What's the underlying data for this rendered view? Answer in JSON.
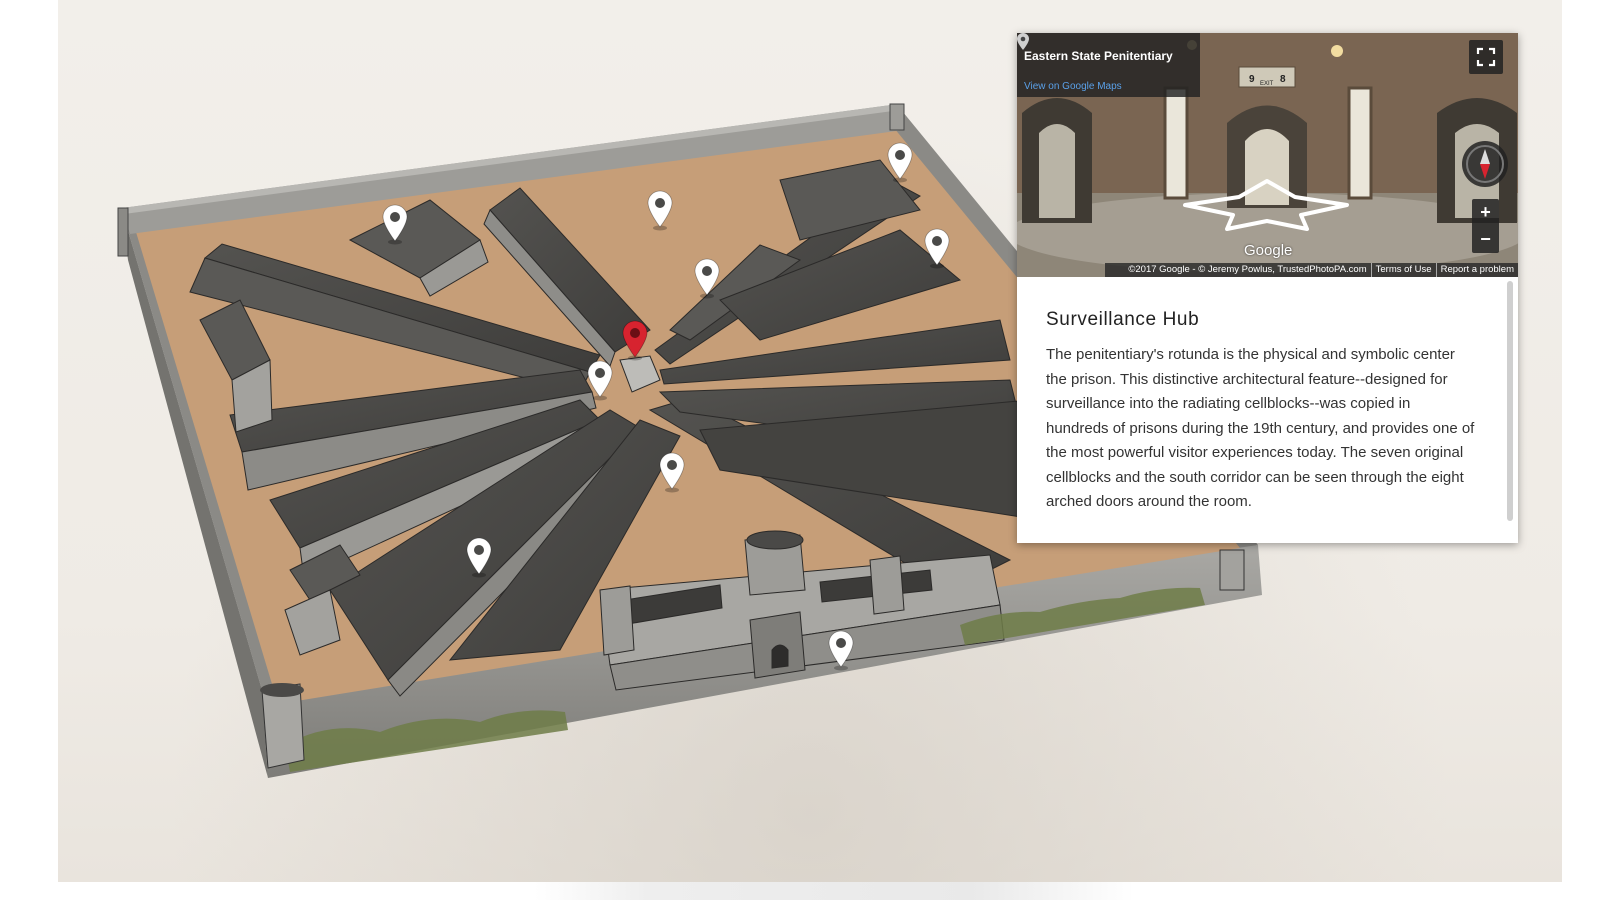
{
  "streetview": {
    "place_title": "Eastern State Penitentiary",
    "view_link": "View on Google Maps",
    "google_logo": "Google",
    "attribution": "©2017 Google - © Jeremy Powlus, TrustedPhotoPA.com",
    "terms": "Terms of Use",
    "report": "Report a problem",
    "zoom_in": "+",
    "zoom_out": "−",
    "sign_left": "9",
    "sign_right": "8",
    "sign_exit": "EXIT"
  },
  "info": {
    "title": "Surveillance Hub",
    "body": "The penitentiary's rotunda is the physical and symbolic center the prison. This distinctive architectural feature--designed for surveillance into the radiating cellblocks--was copied in hundreds of prisons during the 19th century, and provides one of the most powerful visitor experiences today. The seven original cellblocks and the south corridor can be seen through the eight arched doors around the room."
  },
  "map_pins": [
    {
      "name": "pin-northwest-building",
      "active": false
    },
    {
      "name": "pin-north-yard",
      "active": false
    },
    {
      "name": "pin-northeast-corner",
      "active": false
    },
    {
      "name": "pin-east-cellblock",
      "active": false
    },
    {
      "name": "pin-northeast-cellblock",
      "active": false
    },
    {
      "name": "pin-rotunda",
      "active": true
    },
    {
      "name": "pin-central",
      "active": false
    },
    {
      "name": "pin-south-corridor",
      "active": false
    },
    {
      "name": "pin-southwest-cellblock",
      "active": false
    },
    {
      "name": "pin-front-gate",
      "active": false
    }
  ],
  "colors": {
    "pin_default": "#ffffff",
    "pin_active": "#d7232f",
    "roof": "#4a4947",
    "yard": "#c9a07a",
    "wall": "#9b9b98",
    "link": "#5aa0e8"
  }
}
